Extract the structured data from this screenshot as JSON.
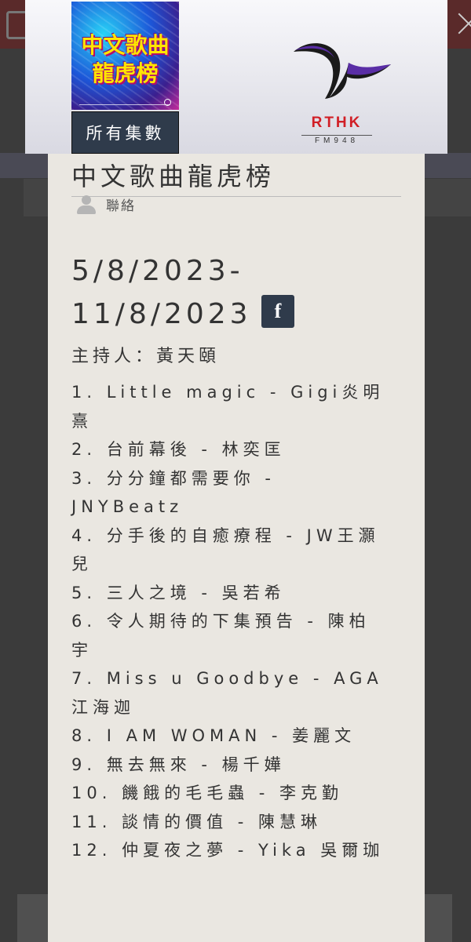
{
  "show": {
    "title": "中文歌曲龍虎榜",
    "cover_line1": "中文歌曲",
    "cover_line2": "龍虎榜",
    "all_episodes_label": "所有集數",
    "contact_label": "聯絡"
  },
  "station": {
    "name": "RTHK",
    "frequency": "FM948",
    "brand_color": "#d11f26"
  },
  "episode": {
    "date_range": "5/8/2023-11/8/2023",
    "facebook_label": "f",
    "host": "主持人：黃天頤",
    "tracks": [
      "1. Little magic - Gigi炎明熹",
      "2. 台前幕後 - 林奕匡",
      "3. 分分鐘都需要你 - JNYBeatz",
      "4. 分手後的自癒療程 - JW王灝兒",
      "5. 三人之境 - 吳若希",
      "6. 令人期待的下集預告 - 陳柏宇",
      "7. Miss u Goodbye - AGA江海迦",
      "8. I AM WOMAN - 姜麗文",
      "9. 無去無來 - 楊千嬅",
      "10. 饑餓的毛毛蟲 - 李克勤",
      "11. 談情的價值 - 陳慧琳",
      "12. 仲夏夜之夢 - Yika 吳爾珈"
    ]
  },
  "icons": {
    "close": "close-icon",
    "user": "user-icon",
    "facebook": "facebook-icon"
  }
}
